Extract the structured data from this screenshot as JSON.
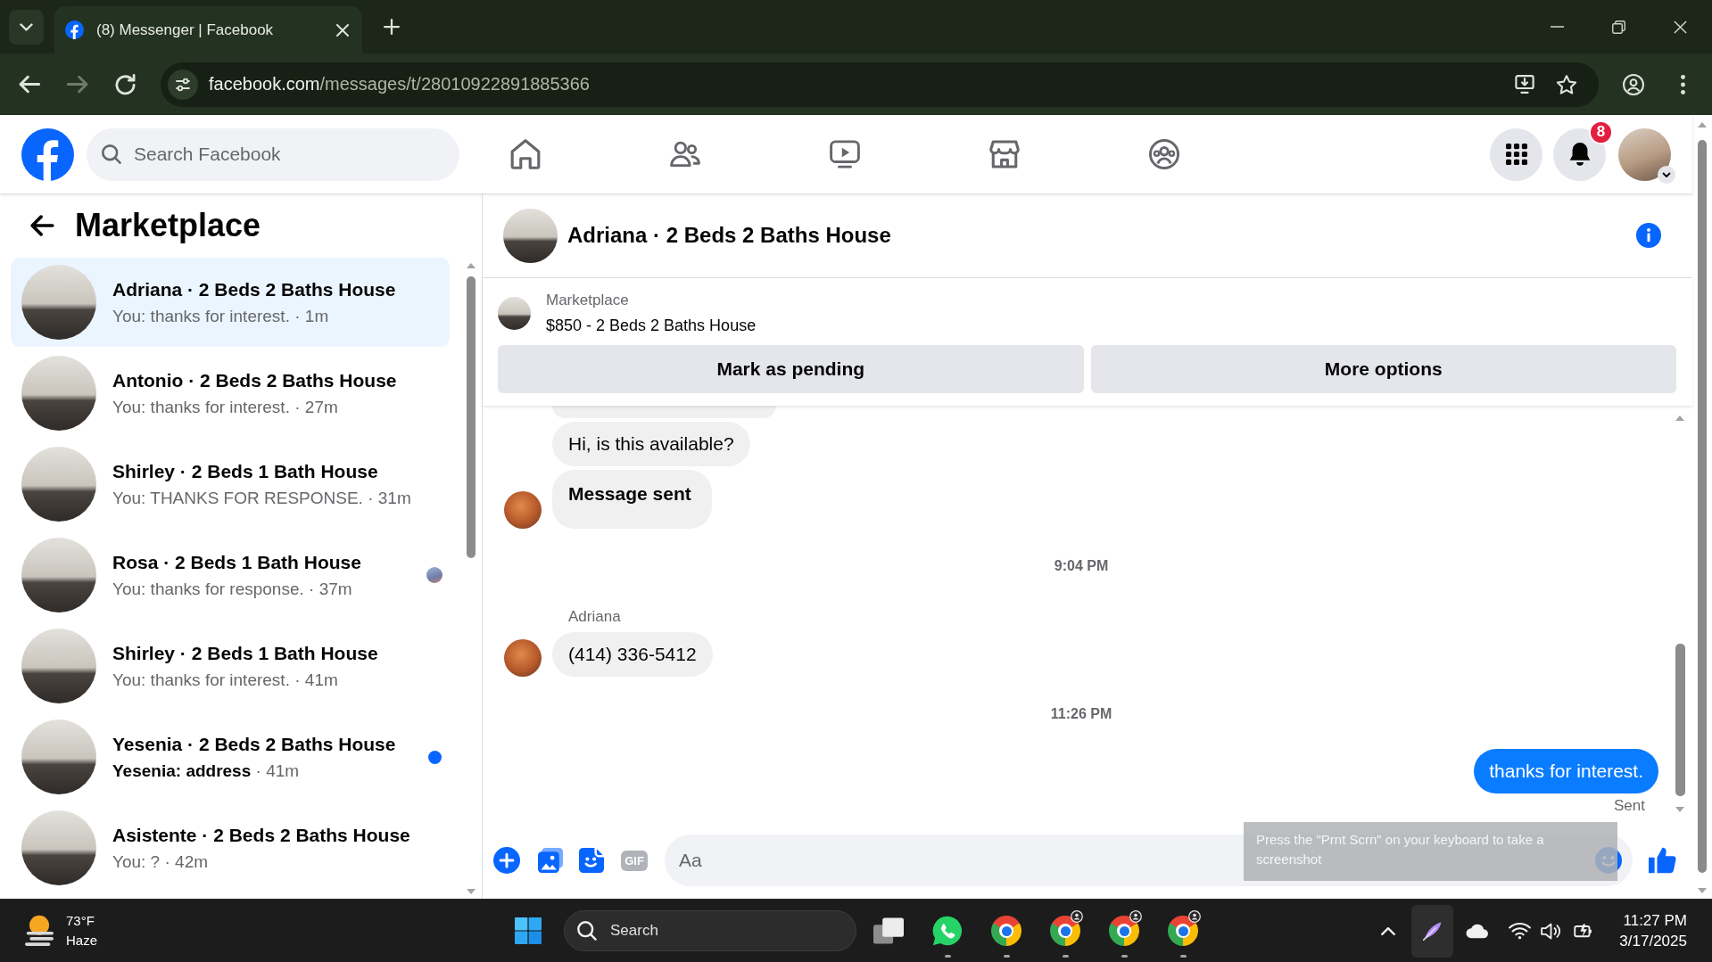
{
  "browser": {
    "tabs": [
      {
        "title": "(8) Messenger | Facebook",
        "selected": true
      }
    ],
    "nav_buttons": [
      {
        "kind": "back",
        "disabled": false
      },
      {
        "kind": "forward",
        "disabled": true
      },
      {
        "kind": "reload",
        "disabled": false
      }
    ],
    "address": {
      "host": "facebook.com",
      "path": "/messages/t/28010922891885366"
    }
  },
  "facebook_header": {
    "search": {
      "placeholder": "Search Facebook"
    },
    "nav": [
      {
        "kind": "home",
        "selected": false
      },
      {
        "kind": "friends",
        "selected": false
      },
      {
        "kind": "video",
        "selected": false
      },
      {
        "kind": "marketplace",
        "selected": false
      },
      {
        "kind": "groups",
        "selected": false
      }
    ],
    "notifications": {
      "badge": "8"
    }
  },
  "sidebar": {
    "title": "Marketplace",
    "conversations": [
      {
        "name": "Adriana · 2 Beds 2 Baths House",
        "preview": "You: thanks for interest.",
        "time": "· 1m",
        "selected": true,
        "unread": false,
        "seen": false
      },
      {
        "name": "Antonio · 2 Beds 2 Baths House",
        "preview": "You: thanks for interest.",
        "time": "· 27m",
        "selected": false,
        "unread": false,
        "seen": false
      },
      {
        "name": "Shirley · 2 Beds 1 Bath House",
        "preview": "You: THANKS FOR RESPONSE.",
        "time": "· 31m",
        "selected": false,
        "unread": false,
        "seen": false
      },
      {
        "name": "Rosa · 2 Beds 1 Bath House",
        "preview": "You: thanks for response.",
        "time": "· 37m",
        "selected": false,
        "unread": false,
        "seen": true
      },
      {
        "name": "Shirley · 2 Beds 1 Bath House",
        "preview": "You: thanks for interest.",
        "time": "· 41m",
        "selected": false,
        "unread": false,
        "seen": false
      },
      {
        "name": "Yesenia · 2 Beds 2 Baths House",
        "preview": "Yesenia: address",
        "time": "· 41m",
        "selected": false,
        "unread": true,
        "seen": false
      },
      {
        "name": "Asistente · 2 Beds 2 Baths House",
        "preview": "You: ?",
        "time": "· 42m",
        "selected": false,
        "unread": false,
        "seen": false
      }
    ]
  },
  "chat": {
    "title": "Adriana · 2 Beds 2 Baths House",
    "listing": {
      "label": "Marketplace",
      "title": "$850 - 2 Beds 2 Baths House"
    },
    "actions": [
      {
        "label": "Mark as pending"
      },
      {
        "label": "More options"
      }
    ],
    "thread": [
      {
        "kind": "incoming",
        "bubbles": [
          {
            "kind": "cut"
          },
          {
            "kind": "text",
            "text": "Hi, is this available?"
          },
          {
            "kind": "notice",
            "text": "Message sent"
          }
        ]
      },
      {
        "kind": "time",
        "text": "9:04 PM"
      },
      {
        "kind": "incoming",
        "sender": "Adriana",
        "bubbles": [
          {
            "kind": "text",
            "text": "(414) 336-5412"
          }
        ]
      },
      {
        "kind": "time",
        "text": "11:26 PM"
      },
      {
        "kind": "outgoing",
        "bubbles": [
          {
            "kind": "text",
            "text": "thanks for interest."
          }
        ],
        "status": "Sent"
      }
    ],
    "composer": {
      "gif_label": "GIF",
      "placeholder": "Aa"
    }
  },
  "screenshot_tip": {
    "text": "Press the \"Prnt Scrn\" on your keyboard to take a screenshot"
  },
  "taskbar": {
    "weather": {
      "temperature": "73°F",
      "condition": "Haze"
    },
    "search": {
      "placeholder": "Search"
    },
    "apps": [
      {
        "kind": "whatsapp",
        "running": true,
        "profile": false
      },
      {
        "kind": "chrome",
        "running": true,
        "profile": false
      },
      {
        "kind": "chrome",
        "running": true,
        "profile": true
      },
      {
        "kind": "chrome",
        "running": true,
        "profile": true
      },
      {
        "kind": "chrome",
        "running": true,
        "profile": true
      }
    ],
    "tray": [
      {
        "kind": "caret",
        "highlighted": false
      },
      {
        "kind": "pen",
        "highlighted": true
      },
      {
        "kind": "cloud",
        "highlighted": false
      },
      {
        "kind": "wifi",
        "highlighted": false
      },
      {
        "kind": "volume",
        "highlighted": false
      },
      {
        "kind": "battery",
        "highlighted": false
      }
    ],
    "clock": {
      "time": "11:27 PM",
      "date": "3/17/2025"
    }
  }
}
